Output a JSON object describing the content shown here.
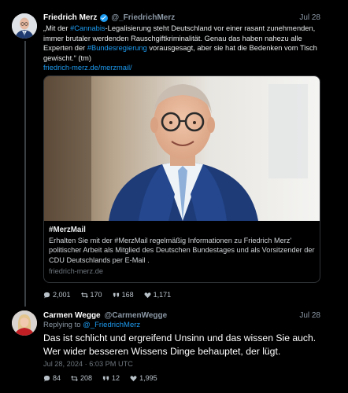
{
  "tweet1": {
    "author_name": "Friedrich Merz",
    "handle": "@_FriedrichMerz",
    "date": "Jul 28",
    "text_parts": [
      "„Mit der ",
      "#Cannabis",
      "-Legalisierung steht Deutschland vor einer rasant zunehmenden, immer brutaler werdenden Rauschgiftkriminalität. Genau das haben nahezu alle Experten der ",
      "#Bundesregierung",
      " vorausgesagt, aber sie hat die Bedenken vom Tisch gewischt.“ (tm)"
    ],
    "link": "friedrich-merz.de/merzmail/",
    "card": {
      "title": "#MerzMail",
      "description": "Erhalten Sie mit der #MerzMail regelmäßig Informationen zu Friedrich Merz' politischer Arbeit als Mitglied des Deutschen Bundestages und als Vorsitzender der CDU Deutschlands per E-Mail .",
      "domain": "friedrich-merz.de"
    },
    "stats": {
      "replies": "2,001",
      "retweets": "170",
      "quotes": "168",
      "likes": "1,171"
    }
  },
  "tweet2": {
    "author_name": "Carmen Wegge",
    "handle": "@CarmenWegge",
    "date": "Jul 28",
    "reply_prefix": "Replying to ",
    "reply_handle": "@_FriedrichMerz",
    "text": "Das ist schlicht und ergreifend Unsinn und das wissen Sie auch. Wer wider besseren Wissens Dinge behauptet, der lügt.",
    "timestamp": "Jul 28, 2024 · 6:03 PM UTC",
    "stats": {
      "replies": "84",
      "retweets": "208",
      "quotes": "12",
      "likes": "1,995"
    }
  },
  "colors": {
    "accent": "#1d9bf0",
    "background": "#000000",
    "muted": "#8b98a5"
  },
  "icons": [
    "verified-badge-icon",
    "reply-icon",
    "retweet-icon",
    "quote-icon",
    "heart-icon"
  ]
}
